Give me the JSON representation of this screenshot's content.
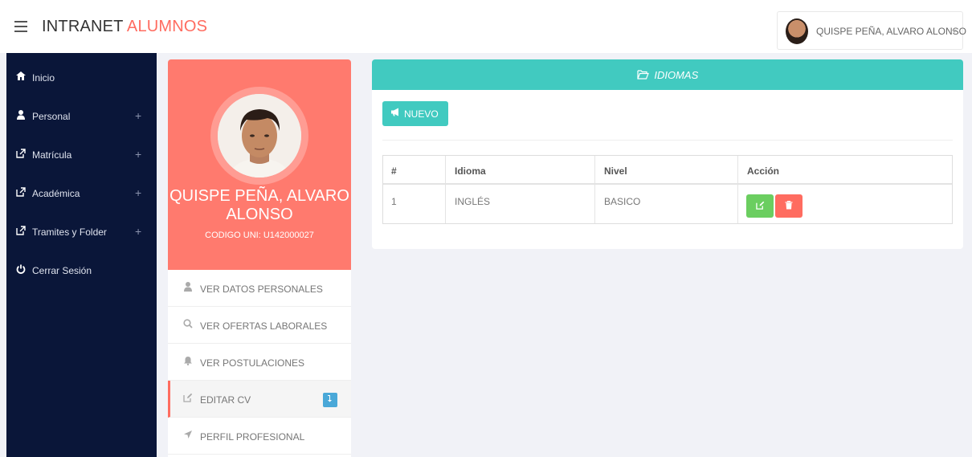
{
  "header": {
    "brand_main": "INTRANET",
    "brand_accent": "ALUMNOS",
    "user_name": "QUISPE PEÑA, ALVARO ALONSO"
  },
  "sidebar": {
    "items": [
      {
        "label": "Inicio",
        "icon": "home-icon",
        "expandable": false
      },
      {
        "label": "Personal",
        "icon": "user-icon",
        "expandable": true
      },
      {
        "label": "Matrícula",
        "icon": "external-link-icon",
        "expandable": true
      },
      {
        "label": "Académica",
        "icon": "external-link-icon",
        "expandable": true
      },
      {
        "label": "Tramites y Folder",
        "icon": "external-link-icon",
        "expandable": true
      },
      {
        "label": "Cerrar Sesión",
        "icon": "power-icon",
        "expandable": false
      }
    ],
    "plus_symbol": "+"
  },
  "profile": {
    "name": "QUISPE PEÑA, ALVARO ALONSO",
    "code": "CODIGO UNI: U142000027"
  },
  "profile_menu": {
    "items": [
      {
        "label": "VER DATOS PERSONALES",
        "icon": "user-icon"
      },
      {
        "label": "VER OFERTAS LABORALES",
        "icon": "search-icon"
      },
      {
        "label": "VER POSTULACIONES",
        "icon": "bell-icon"
      },
      {
        "label": "EDITAR CV",
        "icon": "edit-icon",
        "active": true
      },
      {
        "label": "PERFIL PROFESIONAL",
        "icon": "location-arrow-icon"
      }
    ]
  },
  "panel": {
    "title": "IDIOMAS",
    "new_button": "NUEVO",
    "table": {
      "headers": [
        "#",
        "Idioma",
        "Nivel",
        "Acción"
      ],
      "rows": [
        {
          "num": "1",
          "idioma": "INGLÉS",
          "nivel": "BASICO"
        }
      ]
    }
  },
  "colors": {
    "sidebar_bg": "#0a1639",
    "accent_red": "#ff6c60",
    "profile_bg": "#ff7a6e",
    "teal": "#41cac0",
    "edit_green": "#6bce60",
    "badge_blue": "#4aa8d8"
  }
}
